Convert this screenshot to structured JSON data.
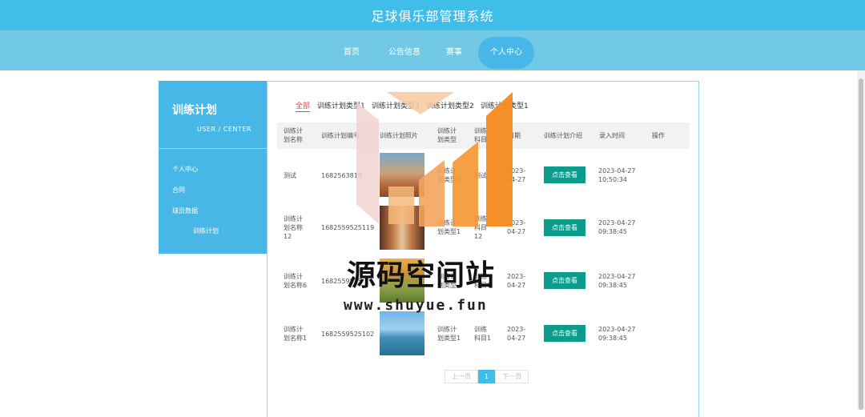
{
  "header": {
    "title": "足球俱乐部管理系统"
  },
  "nav": {
    "items": [
      {
        "label": "首页"
      },
      {
        "label": "公告信息"
      },
      {
        "label": "赛事"
      },
      {
        "label": "个人中心"
      }
    ]
  },
  "sidebar": {
    "title": "训练计划",
    "subtitle": "USER / CENTER",
    "items": [
      {
        "label": "个人中心"
      },
      {
        "label": "合同"
      },
      {
        "label": "球员数据"
      },
      {
        "label": "训练计划"
      }
    ]
  },
  "filters": [
    "全部",
    "训练计划类型1",
    "训练计划类型3",
    "训练计划类型2",
    "训练计划类型1"
  ],
  "table": {
    "headers": {
      "name": "训练计\n划名称",
      "code": "训练计划编号",
      "photo": "训练计划照片",
      "type": "训练计\n划类型",
      "subject": "训练\n科目",
      "date": "日期",
      "intro": "训练计划介绍",
      "entry": "录入时间",
      "op": "操作"
    },
    "rows": [
      {
        "name": "测试",
        "code": "1682563819",
        "type": "训练计\n划类型1",
        "subject": "测试",
        "date": "2023-\n04-27",
        "button": "点击查看",
        "entry": "2023-04-27\n10:50:34"
      },
      {
        "name": "训练计\n划名称\n12",
        "code": "1682559525119",
        "type": "训练计\n划类型1",
        "subject": "训练\n科目\n12",
        "date": "2023-\n04-27",
        "button": "点击查看",
        "entry": "2023-04-27\n09:38:45"
      },
      {
        "name": "训练计\n划名称6",
        "code": "1682559525",
        "type": "训练计\n划类型",
        "subject": "训练\n科目6",
        "date": "2023-\n04-27",
        "button": "点击查看",
        "entry": "2023-04-27\n09:38:45"
      },
      {
        "name": "训练计\n划名称1",
        "code": "1682559525102",
        "type": "训练计\n划类型1",
        "subject": "训练\n科目1",
        "date": "2023-\n04-27",
        "button": "点击查看",
        "entry": "2023-04-27\n09:38:45"
      }
    ]
  },
  "pager": {
    "prev": "上一页",
    "current": "1",
    "next": "下一页"
  },
  "watermark": {
    "title": "源码空间站",
    "url": "www.shuyue.fun"
  },
  "colors": {
    "header": "#40bde8",
    "nav": "#72c9e6",
    "sidebar": "#46b7e6",
    "button": "#0d9c8b",
    "active_filter": "#e2433b",
    "watermark_orange": "#f68a1e"
  }
}
